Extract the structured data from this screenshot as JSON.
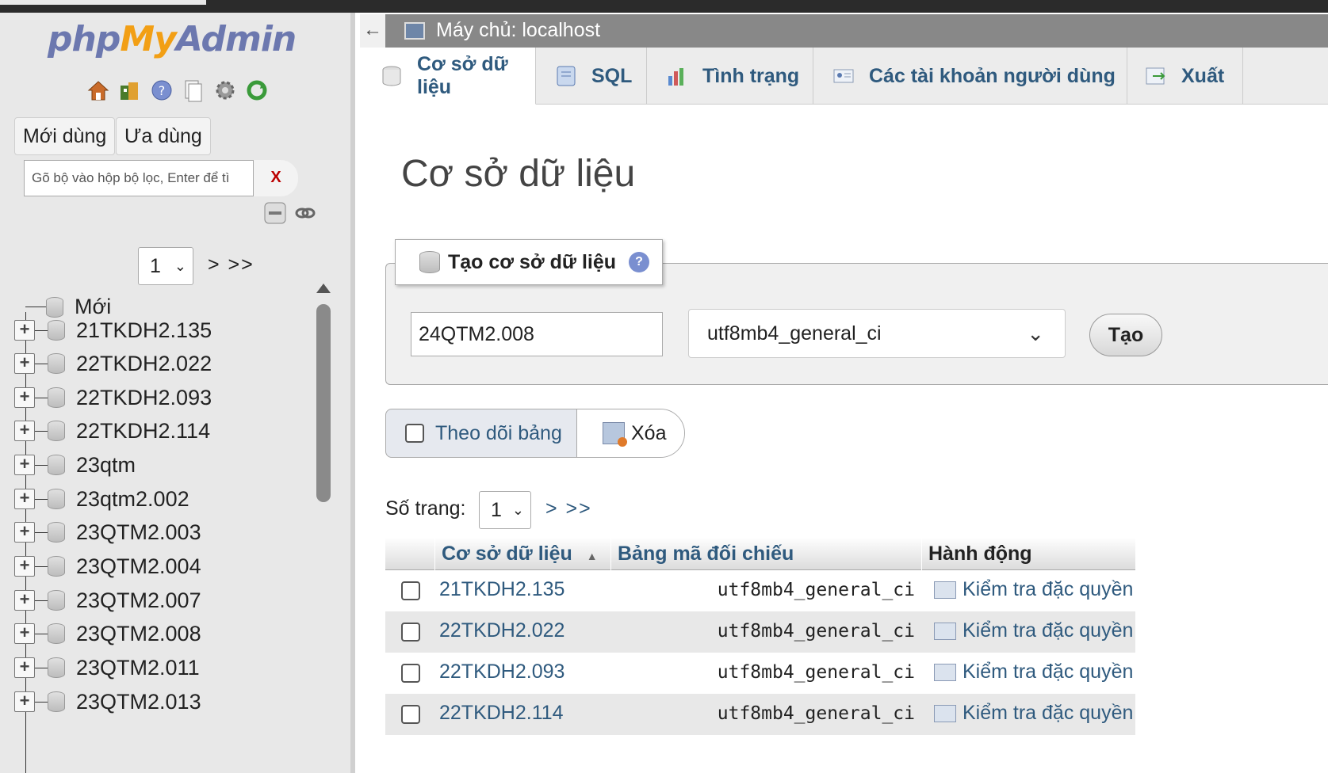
{
  "sidebar": {
    "logo": {
      "php": "php",
      "my": "My",
      "admin": "Admin"
    },
    "nav_icons": [
      "home-icon",
      "database-icon",
      "help-icon",
      "documentation-icon",
      "settings-icon",
      "reload-icon"
    ],
    "recent_label": "Mới dùng",
    "favorites_label": "Ưa dùng",
    "filter_placeholder": "Gõ bộ vào hộp bộ lọc, Enter để tì",
    "filter_clear": "X",
    "pager": {
      "value": "1",
      "next": "> >>"
    },
    "tree": {
      "new_label": "Mới",
      "items": [
        "21TKDH2.135",
        "22TKDH2.022",
        "22TKDH2.093",
        "22TKDH2.114",
        "23qtm",
        "23qtm2.002",
        "23QTM2.003",
        "23QTM2.004",
        "23QTM2.007",
        "23QTM2.008",
        "23QTM2.011",
        "23QTM2.013"
      ]
    }
  },
  "topbar": {
    "back": "←",
    "server": "Máy chủ: localhost"
  },
  "tabs": [
    {
      "label": "Cơ sở dữ liệu",
      "icon": "database-icon",
      "active": true
    },
    {
      "label": "SQL",
      "icon": "sql-icon",
      "active": false
    },
    {
      "label": "Tình trạng",
      "icon": "status-icon",
      "active": false
    },
    {
      "label": "Các tài khoản người dùng",
      "icon": "users-icon",
      "active": false
    },
    {
      "label": "Xuất",
      "icon": "export-icon",
      "active": false
    }
  ],
  "main": {
    "title": "Cơ sở dữ liệu",
    "create": {
      "legend": "Tạo cơ sở dữ liệu",
      "db_name_value": "24QTM2.008",
      "collation_value": "utf8mb4_general_ci",
      "button": "Tạo"
    },
    "track_label": "Theo dõi bảng",
    "delete_label": "Xóa",
    "page_label": "Số trang:",
    "page_value": "1",
    "page_next": "> >>",
    "table": {
      "headers": {
        "database": "Cơ sở dữ liệu",
        "collation": "Bảng mã đối chiếu",
        "action": "Hành động"
      },
      "rows": [
        {
          "name": "21TKDH2.135",
          "collation": "utf8mb4_general_ci",
          "action": "Kiểm tra đặc quyền"
        },
        {
          "name": "22TKDH2.022",
          "collation": "utf8mb4_general_ci",
          "action": "Kiểm tra đặc quyền"
        },
        {
          "name": "22TKDH2.093",
          "collation": "utf8mb4_general_ci",
          "action": "Kiểm tra đặc quyền"
        },
        {
          "name": "22TKDH2.114",
          "collation": "utf8mb4_general_ci",
          "action": "Kiểm tra đặc quyền"
        }
      ]
    }
  },
  "colors": {
    "link": "#2f5a7e",
    "logo_blue": "#6c78af",
    "logo_orange": "#f29f15"
  }
}
